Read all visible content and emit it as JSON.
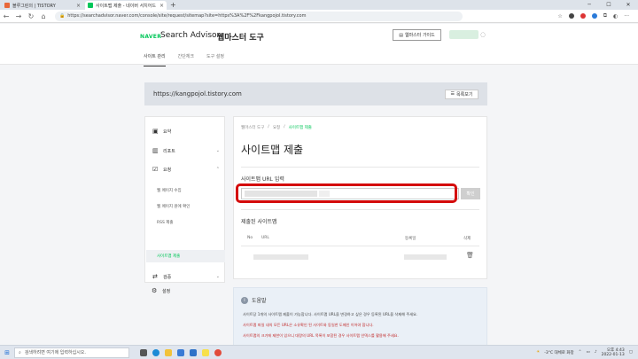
{
  "browser": {
    "tabs": [
      {
        "title": "블루그린의 | TISTORY",
        "favicon_color": "#e8683a"
      },
      {
        "title": "사이트맵 제출 - 네이버 서치어드",
        "favicon_color": "#03c75a"
      }
    ],
    "new_tab": "+",
    "address": "https://searchadvisor.naver.com/console/site/request/sitemap?site=https%3A%2F%2Fkangpojol.tistory.com"
  },
  "header": {
    "naver": "NAVER",
    "title": "Search Advisor",
    "tool": "웹마스터 도구",
    "guide": "웹마스터 가이드",
    "menu": [
      "사이트 관리",
      "간단체크",
      "도구 설정"
    ]
  },
  "site": {
    "url": "https://kangpojol.tistory.com",
    "list_button": "목록보기"
  },
  "sidebar": {
    "items": [
      "요약",
      "리포트",
      "요청",
      "검증",
      "설정"
    ],
    "subitems": [
      "웹 페이지 수집",
      "웹 페이지 원에 확인",
      "RSS 제출",
      "사이트맵 제출"
    ]
  },
  "main": {
    "breadcrumb": [
      "웹마스터 도구",
      "요청",
      "사이트맵 제출"
    ],
    "title": "사이트맵 제출",
    "url_label": "사이트맵 URL 입력",
    "confirm": "확인",
    "submitted_label": "제출된 사이트맵",
    "columns": {
      "no": "No",
      "url": "URL",
      "date": "등록일",
      "delete": "삭제"
    }
  },
  "help": {
    "title": "도움말",
    "lines": [
      "사이트당 1개의 사이트맵 제출이 가능합니다. 사이트맵 URL을 변경하고 싶은 경우 등록된 URL을 삭제해 주세요.",
      "사이트맵 파일 내의 모든 URL은 소유확인 된 사이트와 동일한 도메인 이어야 합니다.",
      "사이트맵의 크기에 제한이 있으니 대량의 URL 목록이 포함된 경우 사이트맵 인덱스를 활용해 주세요."
    ]
  },
  "taskbar": {
    "search": "검색하려면 여기에 입력하십시오.",
    "weather": "-3°C 대체로 화창",
    "time": "오후 4:43",
    "date": "2022-01-13"
  }
}
